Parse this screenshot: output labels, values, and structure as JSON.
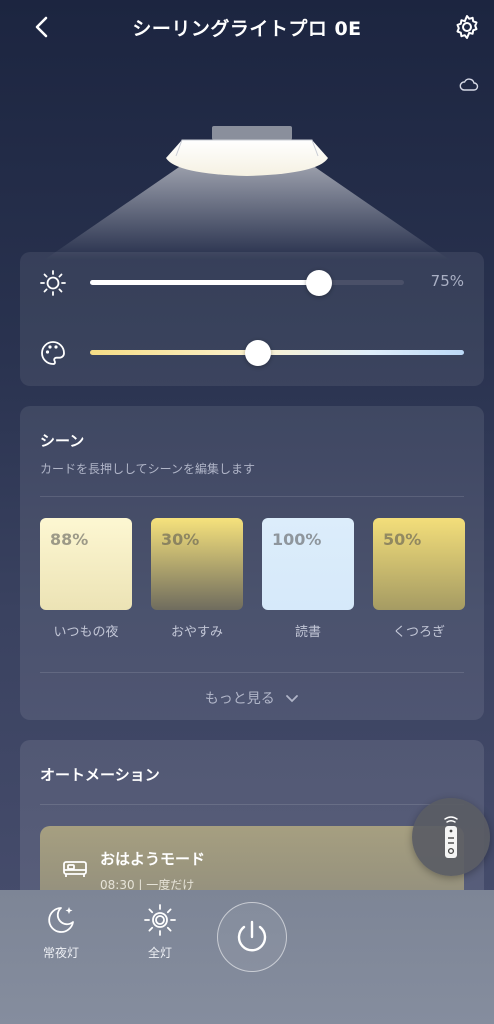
{
  "header": {
    "title": "シーリングライトプロ 0E",
    "back_icon": "chevron-left-icon",
    "settings_icon": "gear-icon",
    "cloud_icon": "cloud-icon"
  },
  "controls": {
    "brightness": {
      "icon": "sun-icon",
      "value_label": "75%",
      "level": 0.73
    },
    "color_temp": {
      "icon": "palette-icon",
      "level": 0.45
    }
  },
  "scenes": {
    "title": "シーン",
    "subtitle": "カードを長押ししてシーンを編集します",
    "items": [
      {
        "percent": "88%",
        "name": "いつもの夜",
        "color_top": "#fdf7d2",
        "color_bottom": "#ece3b5"
      },
      {
        "percent": "30%",
        "name": "おやすみ",
        "color_top": "#f6e27c",
        "color_bottom": "#6f6c5e"
      },
      {
        "percent": "100%",
        "name": "読書",
        "color_top": "#dcedfb",
        "color_bottom": "#d6e9fa"
      },
      {
        "percent": "50%",
        "name": "くつろぎ",
        "color_top": "#f3de7a",
        "color_bottom": "#a59b63"
      }
    ],
    "more_label": "もっと見る"
  },
  "automation": {
    "title": "オートメーション",
    "item": {
      "icon": "bed-icon",
      "name": "おはようモード",
      "detail": "08:30 | 一度だけ"
    }
  },
  "remote": {
    "icon": "remote-icon"
  },
  "bottom": {
    "night_light_label": "常夜灯",
    "full_light_label": "全灯",
    "power_icon": "power-icon"
  },
  "colors": {
    "accent_warm": "#f3de7a",
    "accent_cool": "#dcedfb",
    "background_top": "#1c2540"
  }
}
